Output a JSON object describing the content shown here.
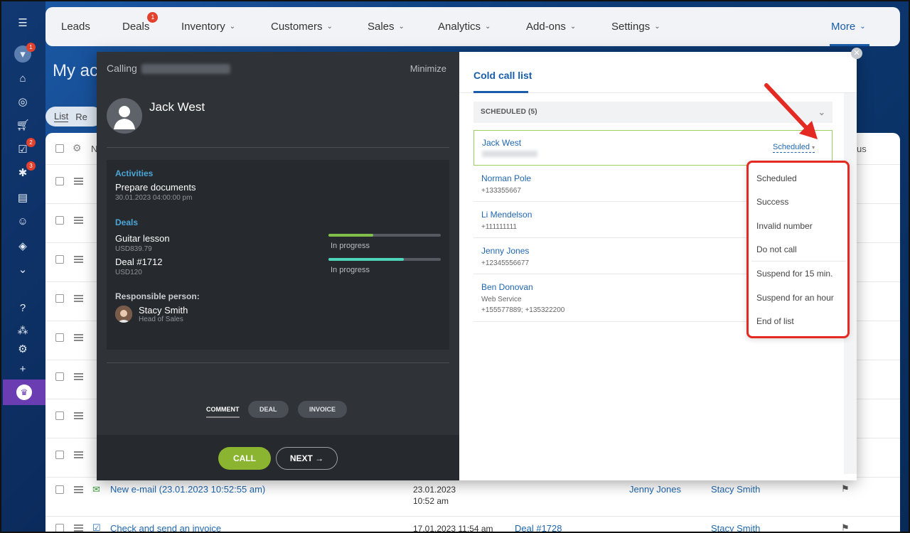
{
  "nav": {
    "items": [
      {
        "label": "Leads",
        "chevron": false
      },
      {
        "label": "Deals",
        "chevron": false,
        "badge": "1"
      },
      {
        "label": "Inventory",
        "chevron": true
      },
      {
        "label": "Customers",
        "chevron": true
      },
      {
        "label": "Sales",
        "chevron": true
      },
      {
        "label": "Analytics",
        "chevron": true
      },
      {
        "label": "Add-ons",
        "chevron": true
      },
      {
        "label": "Settings",
        "chevron": true
      }
    ],
    "more": "More"
  },
  "rail": {
    "badges": {
      "filter": "1",
      "tasks": "2",
      "sites": "3"
    }
  },
  "page": {
    "title": "My ac",
    "tabs": [
      "List",
      "Re"
    ],
    "header_partial": "N",
    "status_partial": "us"
  },
  "rows": [
    {
      "title": "New e-mail (23.01.2023 10:52:55 am)",
      "date": "23.01.2023",
      "time": "10:52 am",
      "contact": "Jenny Jones",
      "responsible": "Stacy Smith"
    },
    {
      "title": "Check and send an invoice",
      "date": "17.01.2023 11:54 am",
      "deal": "Deal #1728",
      "responsible": "Stacy Smith"
    }
  ],
  "call": {
    "calling_label": "Calling",
    "minimize": "Minimize",
    "contact_name": "Jack West",
    "activities_title": "Activities",
    "activity": "Prepare documents",
    "activity_date": "30.01.2023 04:00:00 pm",
    "deals_title": "Deals",
    "deals": [
      {
        "name": "Guitar lesson",
        "amount": "USD839.79",
        "status": "In progress",
        "progress": 0.4
      },
      {
        "name": "Deal #1712",
        "amount": "USD120",
        "status": "In progress",
        "progress": 0.67
      }
    ],
    "responsible_title": "Responsible person:",
    "responsible_name": "Stacy Smith",
    "responsible_role": "Head of Sales",
    "tabs": [
      "COMMENT",
      "DEAL",
      "INVOICE"
    ],
    "call_btn": "CALL",
    "next_btn": "NEXT"
  },
  "list": {
    "title": "Cold call list",
    "group": "SCHEDULED (5)",
    "entries": [
      {
        "name": "Jack West",
        "status": "Scheduled"
      },
      {
        "name": "Norman Pole",
        "phone": "+133355667"
      },
      {
        "name": "Li Mendelson",
        "phone": "+111111111"
      },
      {
        "name": "Jenny Jones",
        "phone": "+12345556677"
      },
      {
        "name": "Ben Donovan",
        "company": "Web Service",
        "phone": "+155577889; +135322200"
      }
    ]
  },
  "menu": {
    "items": [
      "Scheduled",
      "Success",
      "Invalid number",
      "Do not call",
      "Suspend for 15 min.",
      "Suspend for an hour",
      "End of list"
    ]
  },
  "colors": {
    "accent": "#1a5dab",
    "call": "#8bb530",
    "highlight": "#e32a23",
    "selected_border": "#9ccf61"
  }
}
